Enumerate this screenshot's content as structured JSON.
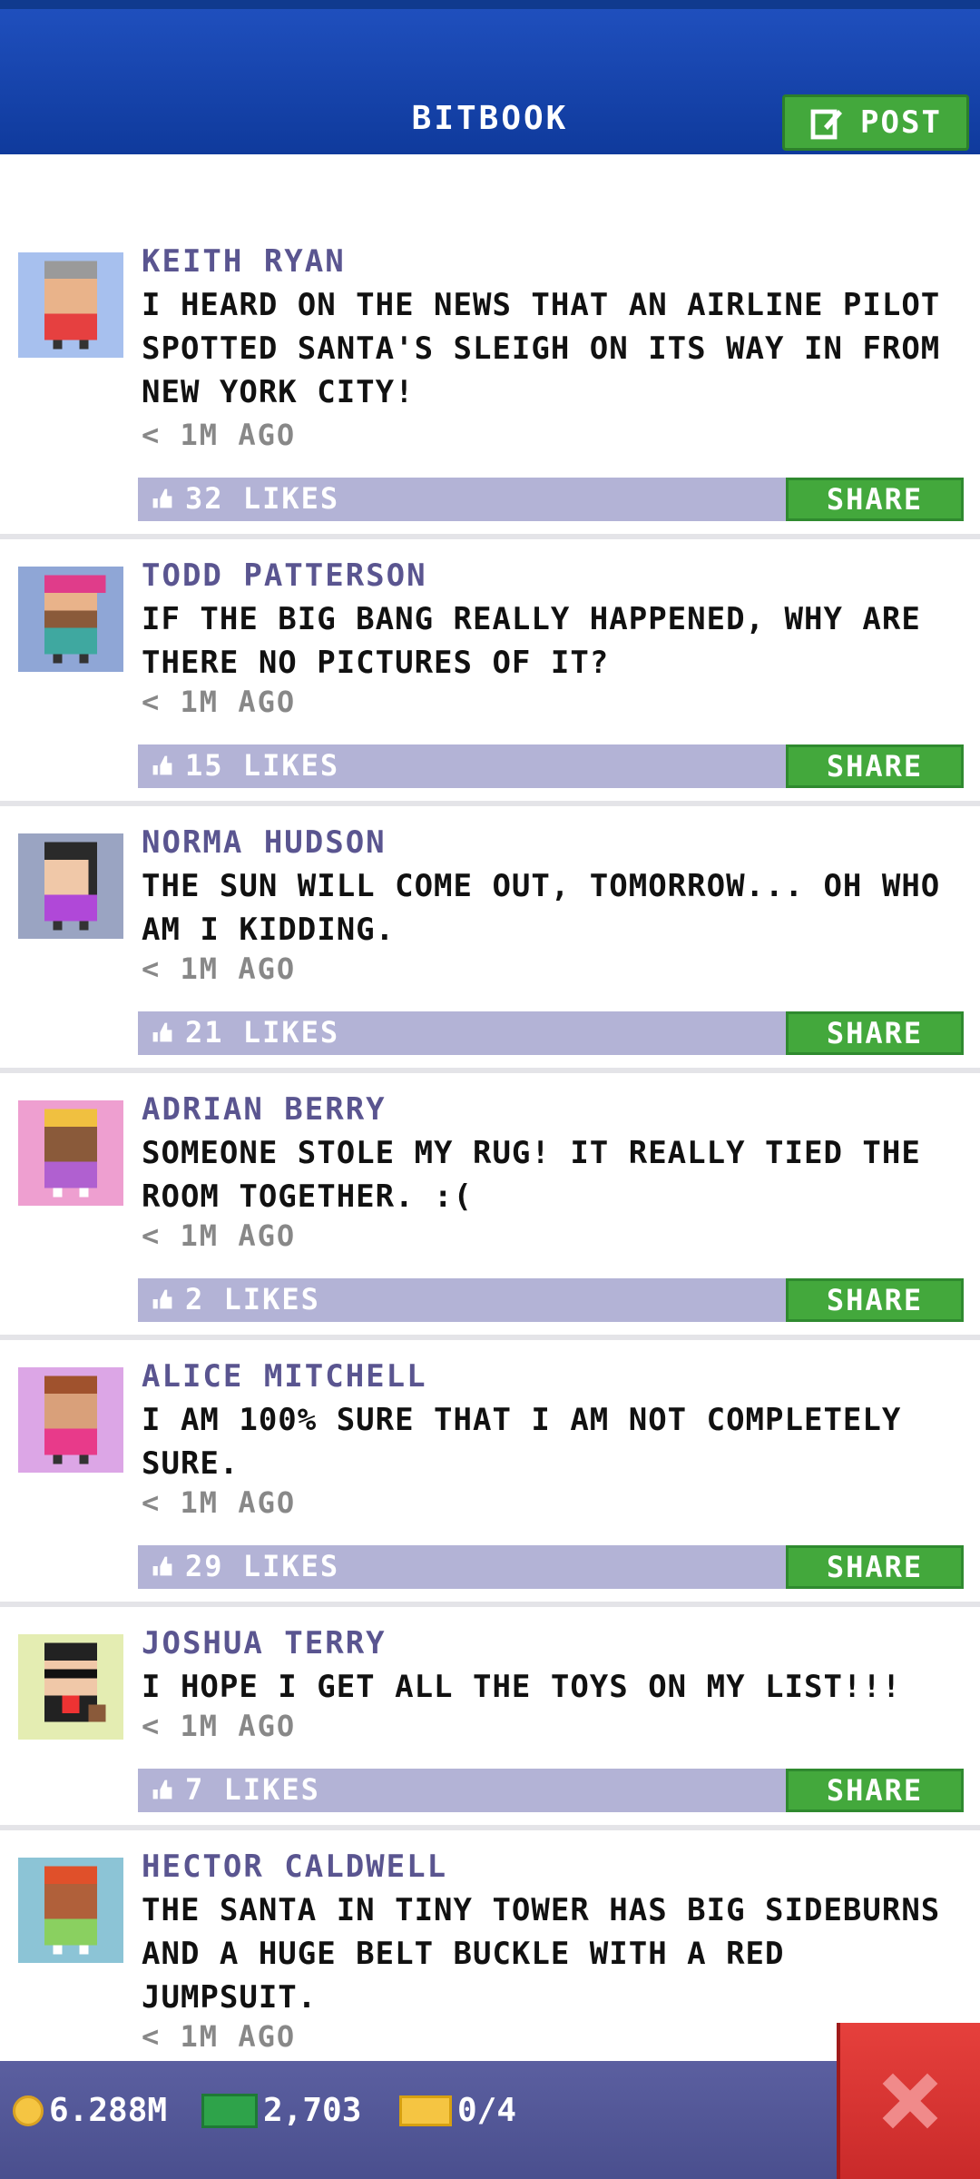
{
  "header": {
    "title": "BITBOOK",
    "post_label": "POST"
  },
  "posts": [
    {
      "name": "KEITH RYAN",
      "message": "I HEARD ON THE NEWS THAT AN AIRLINE PILOT SPOTTED SANTA'S SLEIGH ON ITS WAY IN FROM NEW YORK CITY!",
      "time": "< 1M AGO",
      "likes": "32 LIKES",
      "share": "SHARE",
      "avatar_bg": "#a7c0ee"
    },
    {
      "name": "TODD PATTERSON",
      "message": "IF THE BIG BANG REALLY HAPPENED, WHY ARE THERE NO PICTURES OF IT?",
      "time": "< 1M AGO",
      "likes": "15 LIKES",
      "share": "SHARE",
      "avatar_bg": "#8fa6d6"
    },
    {
      "name": "NORMA HUDSON",
      "message": "THE SUN WILL COME OUT, TOMORROW... OH WHO AM I KIDDING.",
      "time": "< 1M AGO",
      "likes": "21 LIKES",
      "share": "SHARE",
      "avatar_bg": "#9aa4c2"
    },
    {
      "name": "ADRIAN BERRY",
      "message": "SOMEONE STOLE MY RUG! IT REALLY TIED THE ROOM TOGETHER. :(",
      "time": "< 1M AGO",
      "likes": "2 LIKES",
      "share": "SHARE",
      "avatar_bg": "#ee9fd0"
    },
    {
      "name": "ALICE MITCHELL",
      "message": "I AM 100% SURE THAT I AM NOT COMPLETELY SURE.",
      "time": "< 1M AGO",
      "likes": "29 LIKES",
      "share": "SHARE",
      "avatar_bg": "#dca6e6"
    },
    {
      "name": "JOSHUA TERRY",
      "message": "I HOPE I GET ALL THE TOYS ON MY LIST!!!",
      "time": "< 1M AGO",
      "likes": "7 LIKES",
      "share": "SHARE",
      "avatar_bg": "#e4edb2"
    },
    {
      "name": "HECTOR CALDWELL",
      "message": "THE SANTA IN TINY TOWER HAS BIG SIDEBURNS AND A HUGE BELT BUCKLE WITH A RED JUMPSUIT.",
      "time": "< 1M AGO",
      "likes": "",
      "share": "",
      "avatar_bg": "#8cc4d6"
    }
  ],
  "footer": {
    "coins": "6.288M",
    "bux": "2,703",
    "tickets": "0/4"
  },
  "colors": {
    "header": "#1f4fbd",
    "accent_green": "#43a83c",
    "likes_bar": "#b3b3d6",
    "close_red": "#e6403c"
  }
}
